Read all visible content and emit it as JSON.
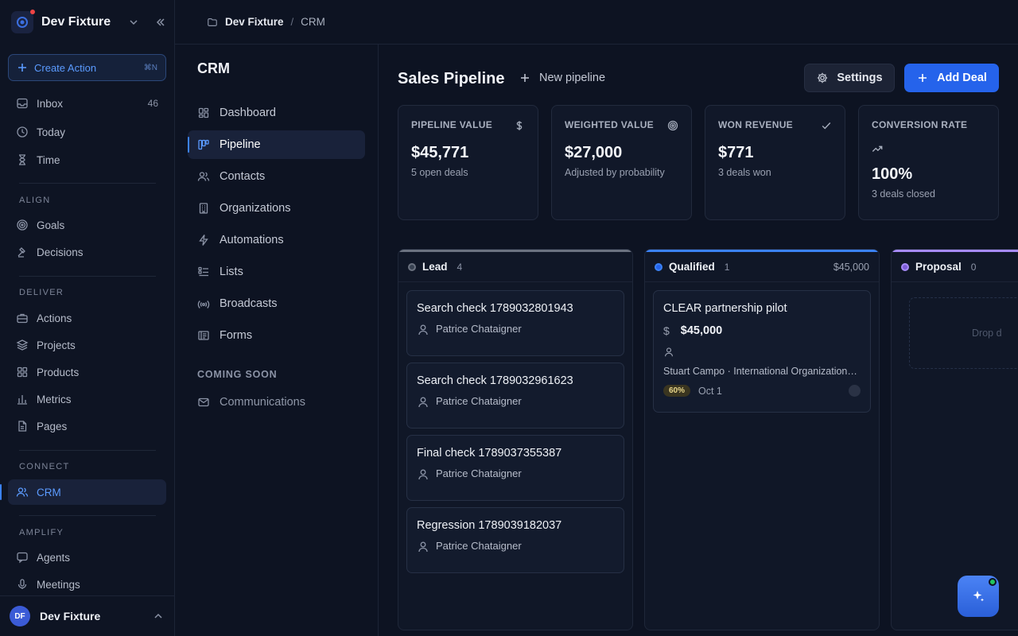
{
  "workspace": {
    "name": "Dev Fixture"
  },
  "sidebar": {
    "create_label": "Create Action",
    "create_shortcut": "⌘N",
    "top_items": [
      {
        "label": "Inbox",
        "count": "46",
        "icon": "inbox-icon"
      },
      {
        "label": "Today",
        "icon": "clock-icon"
      },
      {
        "label": "Time",
        "icon": "hourglass-icon"
      }
    ],
    "sections": [
      {
        "title": "ALIGN",
        "items": [
          {
            "label": "Goals",
            "icon": "target-icon"
          },
          {
            "label": "Decisions",
            "icon": "scale-icon"
          }
        ]
      },
      {
        "title": "DELIVER",
        "items": [
          {
            "label": "Actions",
            "icon": "briefcase-icon"
          },
          {
            "label": "Projects",
            "icon": "layers-icon"
          },
          {
            "label": "Products",
            "icon": "grid-icon"
          },
          {
            "label": "Metrics",
            "icon": "bar-chart-icon"
          },
          {
            "label": "Pages",
            "icon": "file-icon"
          }
        ]
      },
      {
        "title": "CONNECT",
        "items": [
          {
            "label": "CRM",
            "icon": "users-icon",
            "active": true
          }
        ]
      },
      {
        "title": "AMPLIFY",
        "items": [
          {
            "label": "Agents",
            "icon": "chat-icon"
          },
          {
            "label": "Meetings",
            "icon": "mic-icon"
          }
        ]
      }
    ],
    "user": {
      "initials": "DF",
      "name": "Dev Fixture"
    }
  },
  "breadcrumb": {
    "parent": "Dev Fixture",
    "current": "CRM",
    "separator": "/"
  },
  "subnav": {
    "title": "CRM",
    "items": [
      {
        "label": "Dashboard",
        "icon": "dashboard-icon"
      },
      {
        "label": "Pipeline",
        "icon": "kanban-icon",
        "active": true
      },
      {
        "label": "Contacts",
        "icon": "users-icon"
      },
      {
        "label": "Organizations",
        "icon": "building-icon"
      },
      {
        "label": "Automations",
        "icon": "lightning-icon"
      },
      {
        "label": "Lists",
        "icon": "list-icon"
      },
      {
        "label": "Broadcasts",
        "icon": "broadcast-icon"
      },
      {
        "label": "Forms",
        "icon": "form-icon"
      }
    ],
    "coming_soon_title": "COMING SOON",
    "coming_soon_items": [
      {
        "label": "Communications",
        "icon": "mail-icon"
      }
    ]
  },
  "main": {
    "title": "Sales Pipeline",
    "new_pipeline_label": "New pipeline",
    "settings_label": "Settings",
    "add_deal_label": "Add Deal",
    "stats": [
      {
        "label": "PIPELINE VALUE",
        "value": "$45,771",
        "sub": "5 open deals",
        "icon": "dollar-icon"
      },
      {
        "label": "WEIGHTED VALUE",
        "value": "$27,000",
        "sub": "Adjusted by probability",
        "icon": "target-icon"
      },
      {
        "label": "WON REVENUE",
        "value": "$771",
        "sub": "3 deals won",
        "icon": "check-icon"
      },
      {
        "label": "CONVERSION RATE",
        "value": "100%",
        "sub": "3 deals closed",
        "icon": "trending-up-icon"
      }
    ],
    "columns": [
      {
        "name": "Lead",
        "count": "4",
        "total": "",
        "color": "#6b7280",
        "deals": [
          {
            "title": "Search check 1789032801943",
            "owner": "Patrice Chataigner"
          },
          {
            "title": "Search check 1789032961623",
            "owner": "Patrice Chataigner"
          },
          {
            "title": "Final check 1789037355387",
            "owner": "Patrice Chataigner"
          },
          {
            "title": "Regression 1789039182037",
            "owner": "Patrice Chataigner"
          }
        ]
      },
      {
        "name": "Qualified",
        "count": "1",
        "total": "$45,000",
        "color": "#3b82f6",
        "deals": [
          {
            "title": "CLEAR partnership pilot",
            "amount": "$45,000",
            "currency_symbol": "$",
            "company": "Stuart Campo · International Organization…",
            "probability": "60%",
            "date": "Oct 1"
          }
        ]
      },
      {
        "name": "Proposal",
        "count": "0",
        "total": "",
        "color": "#a78bfa",
        "drop_text": "Drop d"
      }
    ]
  },
  "colors": {
    "accent": "#2563eb",
    "background": "#0d1322",
    "lead": "#6b7280",
    "qualified": "#3b82f6",
    "proposal": "#a78bfa"
  }
}
